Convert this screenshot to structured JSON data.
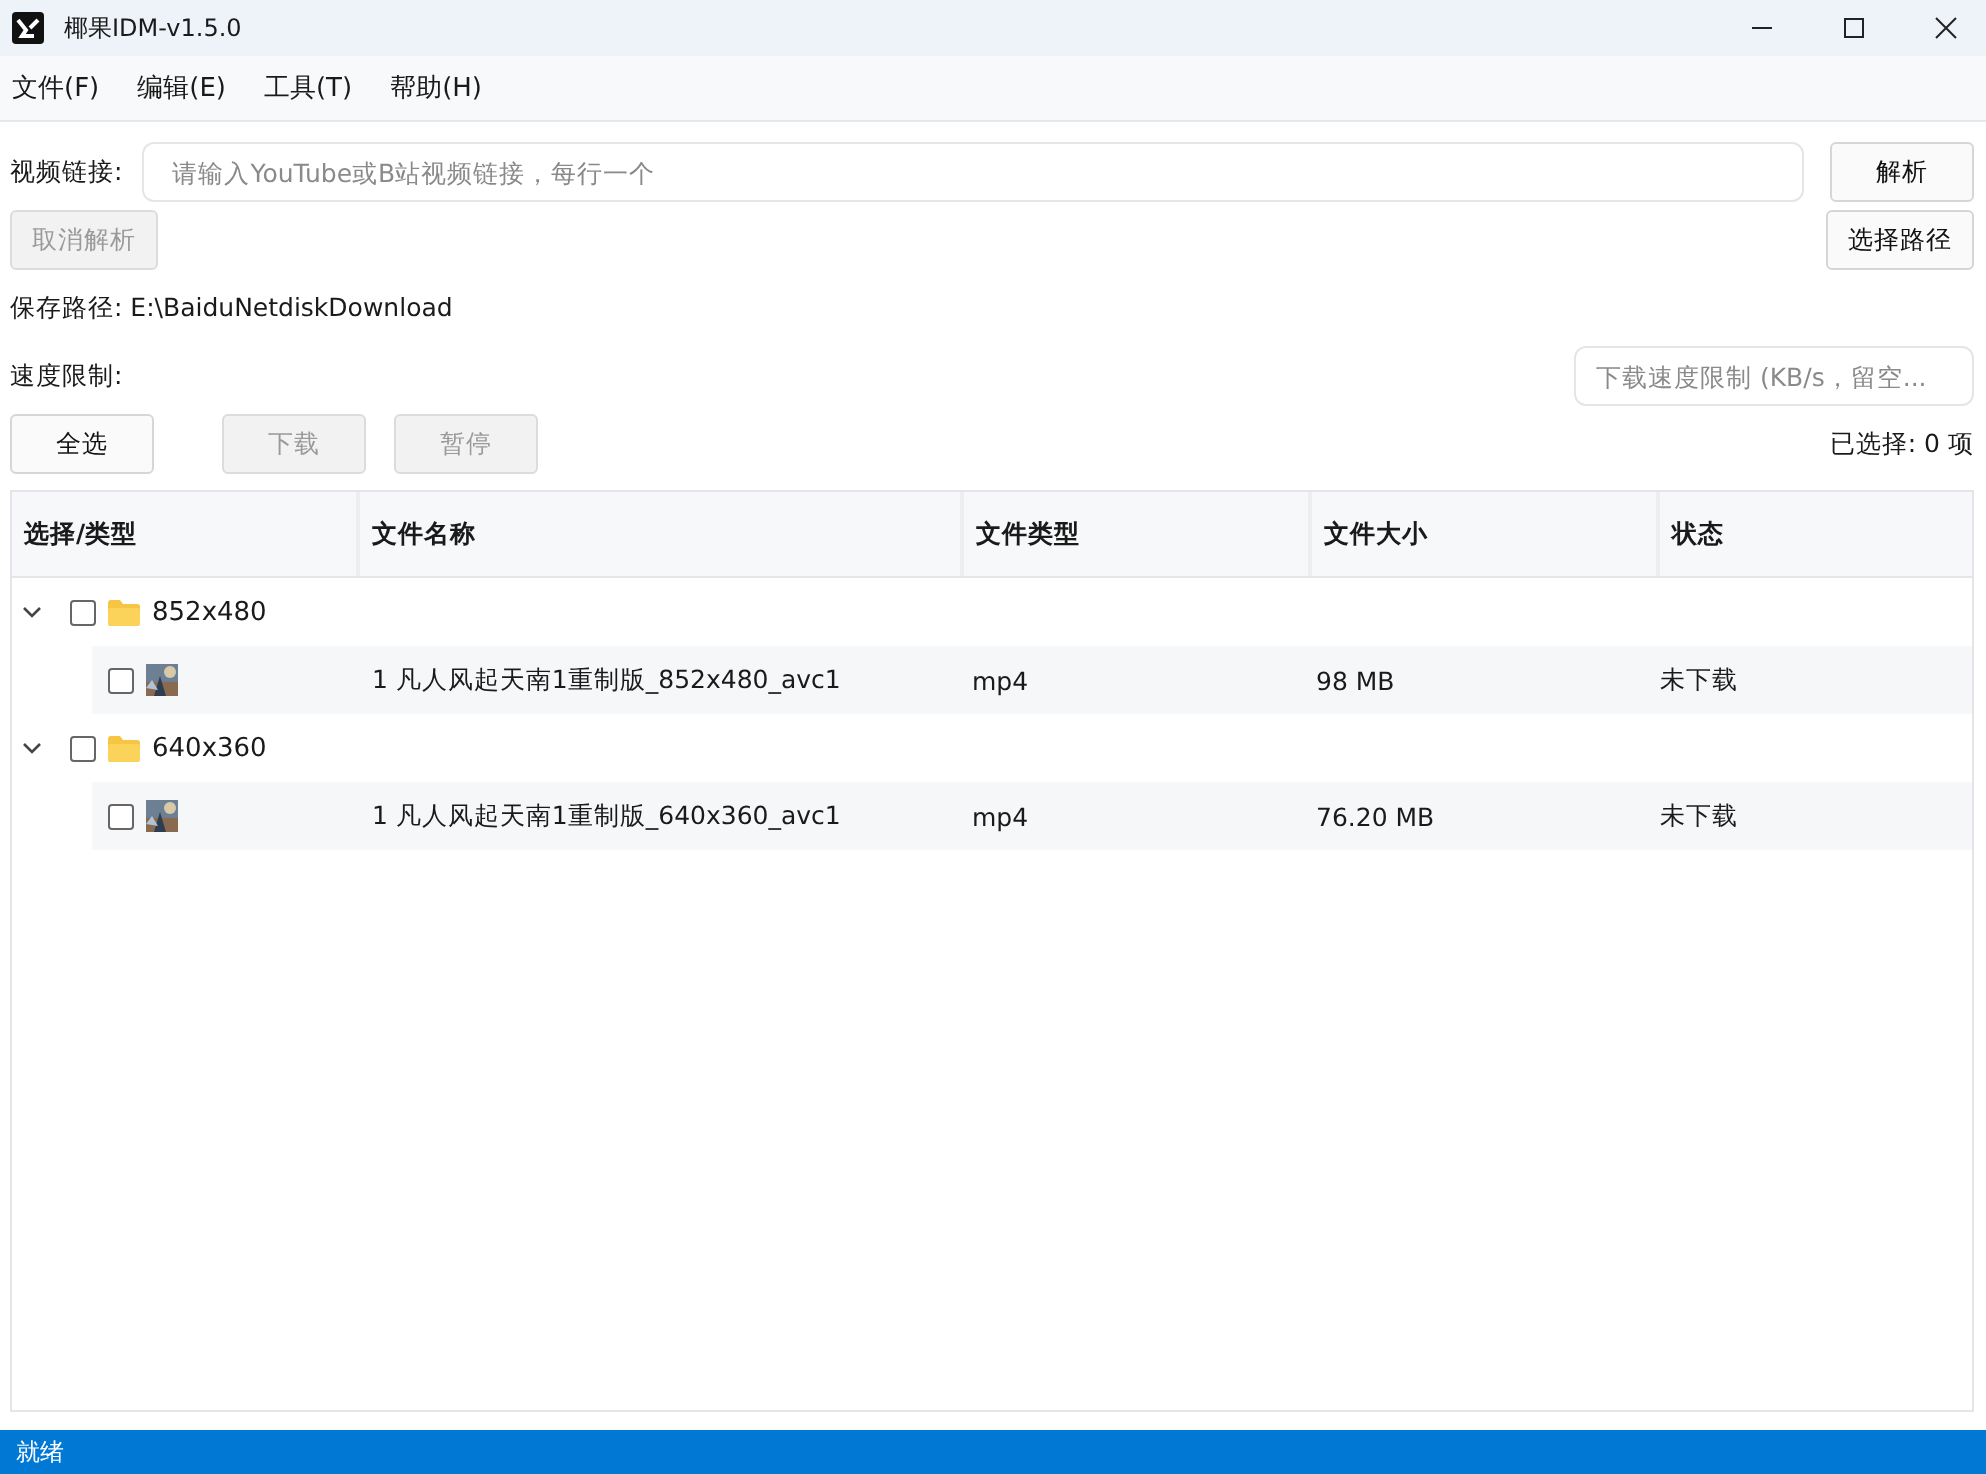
{
  "window": {
    "title": "椰果IDM-v1.5.0"
  },
  "menu": [
    "文件(F)",
    "编辑(E)",
    "工具(T)",
    "帮助(H)"
  ],
  "url": {
    "label": "视频链接:",
    "placeholder": "请输入YouTube或B站视频链接，每行一个"
  },
  "buttons": {
    "parse": {
      "label": "解析",
      "disabled": false
    },
    "cancel": {
      "label": "取消解析",
      "disabled": true
    },
    "choose_path": {
      "label": "选择路径",
      "disabled": false
    },
    "select_all": {
      "label": "全选",
      "disabled": false
    },
    "download": {
      "label": "下载",
      "disabled": true
    },
    "pause": {
      "label": "暂停",
      "disabled": true
    }
  },
  "save_path": "保存路径: E:\\BaiduNetdiskDownload",
  "speed": {
    "label": "速度限制:",
    "placeholder": "下载速度限制 (KB/s，留空..."
  },
  "selected_count": "已选择: 0 项",
  "table": {
    "columns": [
      "选择/类型",
      "文件名称",
      "文件类型",
      "文件大小",
      "状态"
    ],
    "groups": [
      {
        "label": "852x480",
        "expanded": true,
        "checked": false,
        "children": [
          {
            "name": "1 凡人风起天南1重制版_852x480_avc1",
            "type": "mp4",
            "size": "98 MB",
            "status": "未下载",
            "checked": false
          }
        ]
      },
      {
        "label": "640x360",
        "expanded": true,
        "checked": false,
        "children": [
          {
            "name": "1 凡人风起天南1重制版_640x360_avc1",
            "type": "mp4",
            "size": "76.20 MB",
            "status": "未下载",
            "checked": false
          }
        ]
      }
    ]
  },
  "status_bar": "就绪"
}
